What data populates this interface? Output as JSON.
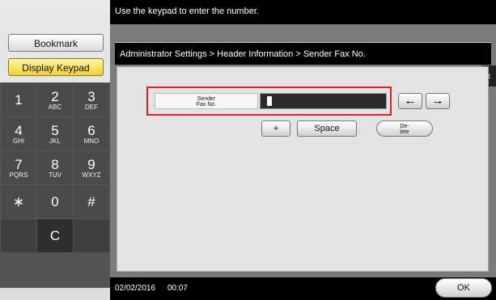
{
  "sidebar": {
    "bookmark_label": "Bookmark",
    "display_keypad_label": "Display Keypad"
  },
  "keypad": {
    "keys": [
      {
        "num": "1",
        "sub": ""
      },
      {
        "num": "2",
        "sub": "ABC"
      },
      {
        "num": "3",
        "sub": "DEF"
      },
      {
        "num": "4",
        "sub": "GHI"
      },
      {
        "num": "5",
        "sub": "JKL"
      },
      {
        "num": "6",
        "sub": "MNO"
      },
      {
        "num": "7",
        "sub": "PQRS"
      },
      {
        "num": "8",
        "sub": "TUV"
      },
      {
        "num": "9",
        "sub": "WXYZ"
      },
      {
        "num": "∗",
        "sub": ""
      },
      {
        "num": "0",
        "sub": ""
      },
      {
        "num": "#",
        "sub": ""
      }
    ],
    "clear_label": "C"
  },
  "header": {
    "message": "Use the keypad to enter the number."
  },
  "breadcrumb": "Administrator Settings > Header Information > Sender Fax No.",
  "collapse_icon": "«",
  "field": {
    "label_line1": "Sender",
    "label_line2": "Fax No.",
    "value": ""
  },
  "buttons": {
    "left_arrow": "←",
    "right_arrow": "→",
    "plus": "+",
    "space": "Space",
    "delete_line1": "De-",
    "delete_line2": "lete",
    "ok": "OK"
  },
  "status": {
    "date": "02/02/2016",
    "time": "00:07"
  }
}
